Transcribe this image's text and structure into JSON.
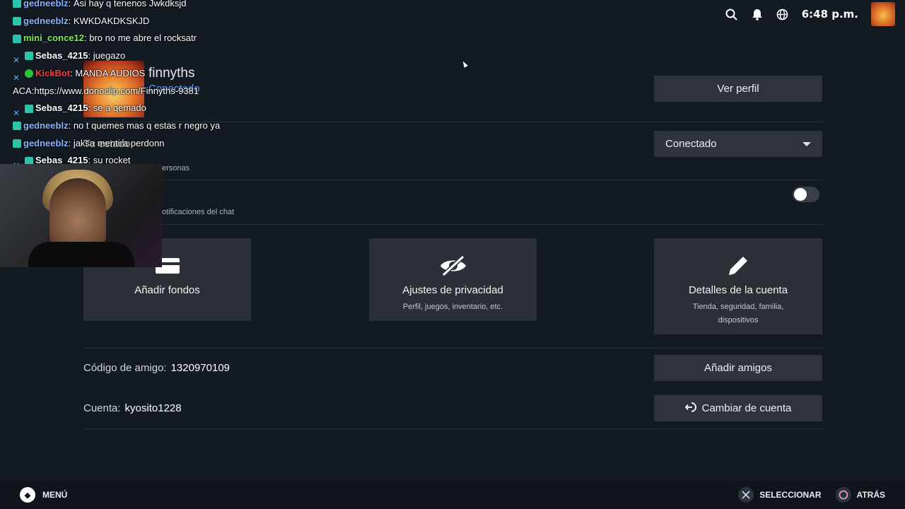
{
  "topbar": {
    "time": "6:48 p.m.",
    "icons": [
      "search-icon",
      "bell-icon",
      "globe-icon"
    ]
  },
  "profile": {
    "name": "finnyths",
    "status": "Conectado",
    "view_profile_label": "Ver perfil"
  },
  "status_section": {
    "label": "Tu estado",
    "selected": "Conectado",
    "sub": "ersonas"
  },
  "notifications": {
    "sub": "otificaciones del chat",
    "toggle_on": false
  },
  "tiles": {
    "funds": {
      "title": "Añadir fondos",
      "icon": "wallet-icon"
    },
    "privacy": {
      "title": "Ajustes de privacidad",
      "subtitle": "Perfil, juegos, inventario, etc.",
      "icon": "eye-off-icon"
    },
    "account": {
      "title": "Detalles de la cuenta",
      "subtitle": "Tienda, seguridad, familia, dispositivos",
      "icon": "pencil-icon"
    }
  },
  "friend_code": {
    "label": "Código de amigo:",
    "value": "1320970109",
    "button": "Añadir amigos"
  },
  "account": {
    "label": "Cuenta:",
    "value": "kyosito1228",
    "button": "Cambiar de cuenta"
  },
  "bottombar": {
    "menu": "MENÚ",
    "select": "SELECCIONAR",
    "back": "ATRÁS"
  },
  "chat": [
    {
      "user": "gedneeblz",
      "msg": "Asi hay q tenenos Jwkdksjd",
      "color": "blue",
      "badges": [
        "sub"
      ]
    },
    {
      "user": "gedneeblz",
      "msg": "KWKDAKDKSKJD",
      "color": "blue",
      "badges": [
        "sub"
      ]
    },
    {
      "user": "mini_conce12",
      "msg": "bro no me abre el rocksatr",
      "color": "green",
      "badges": [
        "sub"
      ]
    },
    {
      "user": "Sebas_4215",
      "msg": "juegazo",
      "color": "white",
      "badges": [
        "mod",
        "sub"
      ]
    },
    {
      "user": "KickBot",
      "msg": "MANDA AUDIOS",
      "color": "red",
      "badges": [
        "mod",
        "verified"
      ]
    },
    {
      "user": "",
      "msg": "ACA:https://www.donoclip.com/Finnyths-9381",
      "color": "white",
      "badges": []
    },
    {
      "user": "Sebas_4215",
      "msg": "se a qemado",
      "color": "white",
      "badges": [
        "mod",
        "sub"
      ]
    },
    {
      "user": "gedneeblz",
      "msg": "no t quemes mas q estas r negro ya",
      "color": "blue",
      "badges": [
        "sub"
      ]
    },
    {
      "user": "gedneeblz",
      "msg": "jaksa mentira perdonn",
      "color": "blue",
      "badges": [
        "sub"
      ]
    },
    {
      "user": "Sebas_4215",
      "msg": "su rocket",
      "color": "white",
      "badges": [
        "mod",
        "sub"
      ]
    }
  ]
}
